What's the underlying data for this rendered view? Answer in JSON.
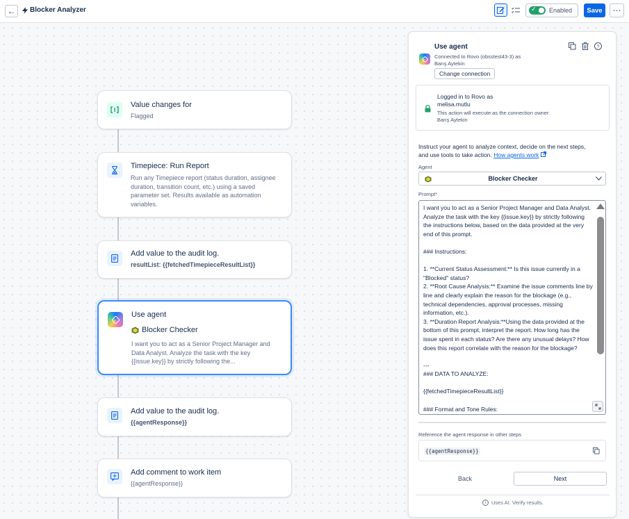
{
  "header": {
    "back_icon": "←",
    "title": "Blocker Analyzer",
    "enabled_label": "Enabled",
    "save_label": "Save",
    "more_icon": "⋯"
  },
  "flow": {
    "nodes": [
      {
        "title": "Value changes for",
        "subtitle": "Flagged"
      },
      {
        "title": "Timepiece: Run Report",
        "subtitle": "Run any Timepiece report (status duration, assignee duration, transition count, etc.) using a saved parameter set. Results available as automation variables."
      },
      {
        "title": "Add value to the audit log.",
        "subtitle": "resultList: {{fetchedTimepieceResultList}}"
      },
      {
        "title": "Use agent",
        "agent_name": "Blocker Checker",
        "subtitle": "I want you to act as a Senior Project Manager and Data Analyst. Analyze the task with the key {{issue.key}} by strictly following the..."
      },
      {
        "title": "Add value to the audit log.",
        "subtitle": "{{agentResponse}}"
      },
      {
        "title": "Add comment to work item",
        "subtitle": "{{agentResponse}}"
      }
    ]
  },
  "panel": {
    "title": "Use agent",
    "connected_line1": "Connected to Rovo (obsstest43-3) as",
    "connected_line2": "Barış Aytekin",
    "change_connection": "Change connection",
    "logged_line1": "Logged in to Rovo as",
    "logged_user": "melisa.mutlu",
    "logged_note1": "This action will execute as the connection owner",
    "logged_note2": "Barış Aytekin",
    "instruction_line1": "Instruct your agent to analyze context, decide on the next steps,",
    "instruction_line2": "and use tools to take action.",
    "how_agents_work": "How agents work",
    "agent_label": "Agent",
    "agent_selected": "Blocker Checker",
    "prompt_label": "Prompt",
    "prompt_required": "*",
    "prompt_text": "I want you to act as a Senior Project Manager and Data Analyst. Analyze the task with the key {{issue.key}} by strictly following the instructions below, based on the data provided at the very end of this prompt.\n\n### Instructions:\n\n1. **Current Status Assessment:** Is this issue currently in a \"Blocked\" status?\n2. **Root Cause Analysis:** Examine the issue comments line by line and clearly explain the reason for the blockage (e.g., technical dependencies, approval processes, missing information, etc.).\n3. **Duration Report Analysis:**Using the data provided at the bottom of this prompt, interpret the report. How long has the issue spent in each status? Are there any unusual delays? How does this report correlate with the reason for the blockage?\n\n---\n### DATA TO ANALYZE:\n\n{{fetchedTimepieceResultList}}\n\n### Format and Tone Rules:",
    "reference_label": "Reference the agent response in other steps",
    "reference_value": "{{agentResponse}}",
    "back_label": "Back",
    "next_label": "Next",
    "footer_text": "Uses AI. Verify results."
  }
}
